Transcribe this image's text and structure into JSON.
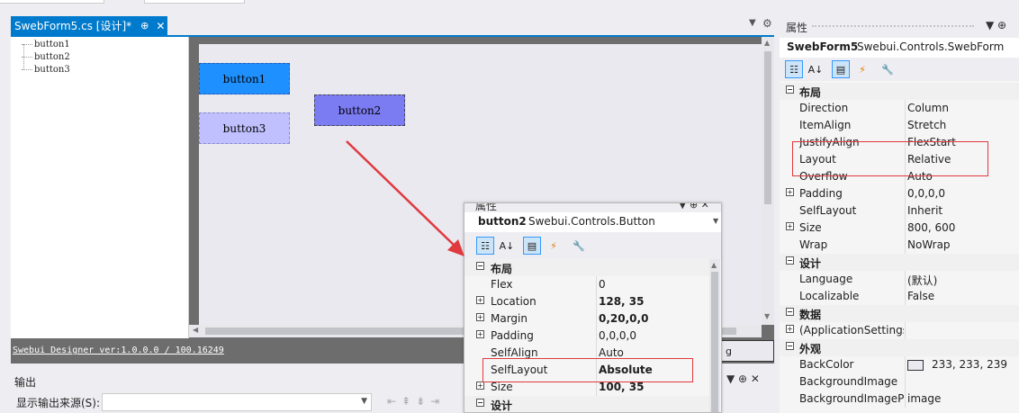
{
  "document_tab": {
    "title": "SwebForm5.cs [设计]*",
    "pin": "⊕",
    "close": "✕"
  },
  "tree": {
    "items": [
      "button1",
      "button2",
      "button3"
    ]
  },
  "designer": {
    "buttons": [
      {
        "label": "button1"
      },
      {
        "label": "button2"
      },
      {
        "label": "button3"
      }
    ],
    "status_text": "Swebui Designer ver:1.0.0.0 / 100.16249",
    "status_button_label": "g"
  },
  "output_panel": {
    "title": "输出",
    "source_label": "显示输出来源(S):",
    "source_value": ""
  },
  "properties_panel": {
    "title": "属性",
    "object_name": "SwebForm5",
    "object_type": "Swebui.Controls.SwebForm",
    "rows": [
      {
        "kind": "cat",
        "name": "布局"
      },
      {
        "kind": "prop",
        "name": "Direction",
        "value": "Column"
      },
      {
        "kind": "prop",
        "name": "ItemAlign",
        "value": "Stretch"
      },
      {
        "kind": "prop",
        "name": "JustifyAlign",
        "value": "FlexStart"
      },
      {
        "kind": "prop",
        "name": "Layout",
        "value": "Relative"
      },
      {
        "kind": "prop",
        "name": "Overflow",
        "value": "Auto"
      },
      {
        "kind": "prop",
        "name": "Padding",
        "value": "0,0,0,0",
        "expandable": true
      },
      {
        "kind": "prop",
        "name": "SelfLayout",
        "value": "Inherit"
      },
      {
        "kind": "prop",
        "name": "Size",
        "value": "800, 600",
        "expandable": true
      },
      {
        "kind": "prop",
        "name": "Wrap",
        "value": "NoWrap"
      },
      {
        "kind": "cat",
        "name": "设计"
      },
      {
        "kind": "prop",
        "name": "Language",
        "value": "(默认)"
      },
      {
        "kind": "prop",
        "name": "Localizable",
        "value": "False"
      },
      {
        "kind": "cat",
        "name": "数据"
      },
      {
        "kind": "prop",
        "name": "(ApplicationSettings",
        "value": "",
        "expandable": true
      },
      {
        "kind": "cat",
        "name": "外观"
      },
      {
        "kind": "prop",
        "name": "BackColor",
        "value": "233, 233, 239",
        "swatch": "#e9e9ef"
      },
      {
        "kind": "prop",
        "name": "BackgroundImage",
        "value": ""
      },
      {
        "kind": "prop",
        "name": "BackgroundImageP",
        "value": "image"
      }
    ]
  },
  "floating_properties": {
    "title": "属性",
    "object_name": "button2",
    "object_type": "Swebui.Controls.Button",
    "rows": [
      {
        "kind": "cat",
        "name": "布局"
      },
      {
        "kind": "prop",
        "name": "Flex",
        "value": "0"
      },
      {
        "kind": "prop",
        "name": "Location",
        "value": "128, 35",
        "expandable": true,
        "bold": true
      },
      {
        "kind": "prop",
        "name": "Margin",
        "value": "0,20,0,0",
        "expandable": true,
        "bold": true
      },
      {
        "kind": "prop",
        "name": "Padding",
        "value": "0,0,0,0",
        "expandable": true
      },
      {
        "kind": "prop",
        "name": "SelfAlign",
        "value": "Auto"
      },
      {
        "kind": "prop",
        "name": "SelfLayout",
        "value": "Absolute",
        "bold": true
      },
      {
        "kind": "prop",
        "name": "Size",
        "value": "100, 35",
        "expandable": true,
        "bold": true
      },
      {
        "kind": "cat",
        "name": "设计"
      }
    ]
  },
  "colors": {
    "accent": "#007acc",
    "button1": "#1e90ff",
    "button2": "#7b7bf2",
    "button3": "#c0c0ff",
    "annotation_red": "#e0393e"
  }
}
